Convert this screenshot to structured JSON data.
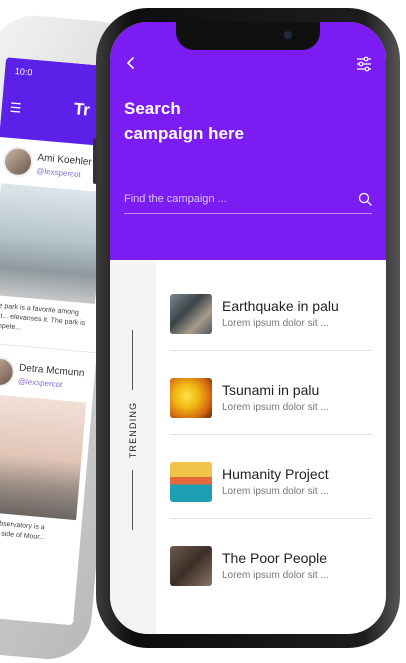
{
  "back_phone": {
    "status_time": "10:0",
    "title": "Tr",
    "posts": [
      {
        "name": "Ami Koehler",
        "handle": "@lexspercot",
        "text": "The park is a favorite among skat... elevanses it. The park is compete..."
      },
      {
        "name": "Detra Mcmunn",
        "handle": "@lexspercot",
        "text": "Griffith Observatory is a favorite... side of Mour..."
      }
    ]
  },
  "header": {
    "title": "Search\ncampaign here",
    "back_icon": "chevron-left-icon",
    "filter_icon": "sliders-icon"
  },
  "search": {
    "placeholder": "Find the campaign ...",
    "icon": "search-icon"
  },
  "sidebar": {
    "label": "TRENDING"
  },
  "campaigns": [
    {
      "title": "Earthquake in palu",
      "desc": "Lorem ipsum dolor sit ..."
    },
    {
      "title": "Tsunami in palu",
      "desc": "Lorem ipsum dolor sit ..."
    },
    {
      "title": "Humanity Project",
      "desc": "Lorem ipsum dolor sit ..."
    },
    {
      "title": "The Poor People",
      "desc": "Lorem ipsum dolor sit ..."
    }
  ],
  "colors": {
    "accent": "#7a1cf2",
    "back_accent": "#5b21e8"
  }
}
